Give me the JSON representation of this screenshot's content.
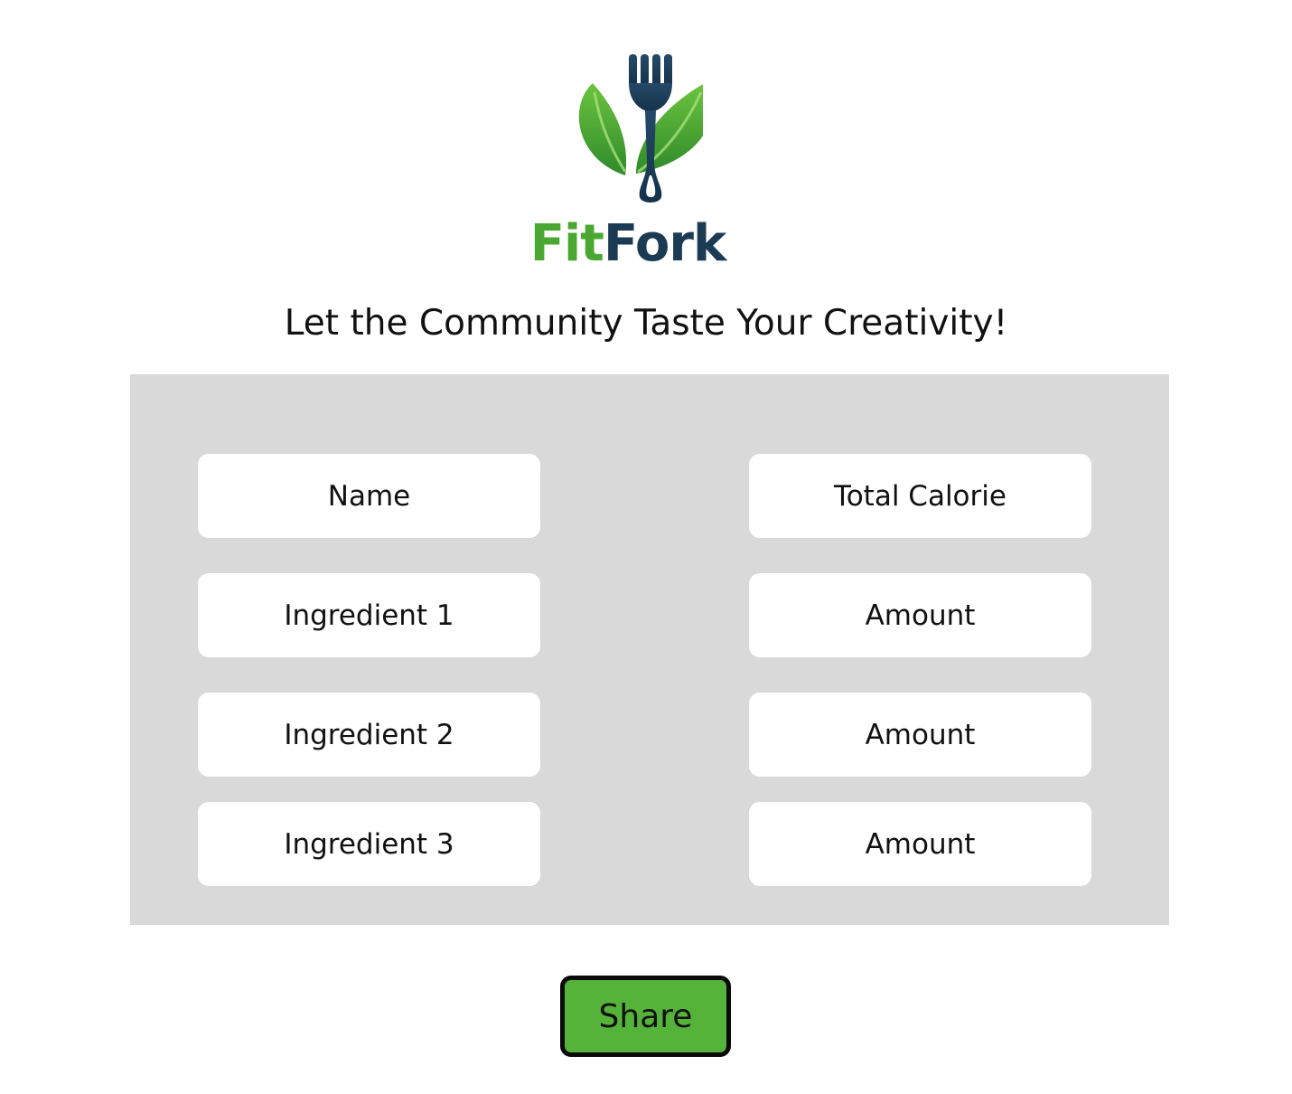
{
  "brand": {
    "name_part1": "Fit",
    "name_part2": "Fork",
    "logo_icon": "fork-with-leaves-icon",
    "colors": {
      "green": "#4aa832",
      "navy": "#1b3b55"
    }
  },
  "headline": "Let the Community Taste Your Creativity!",
  "form": {
    "name_placeholder": "Name",
    "total_calorie_placeholder": "Total Calorie",
    "ingredients": [
      {
        "ingredient_placeholder": "Ingredient 1",
        "amount_placeholder": "Amount"
      },
      {
        "ingredient_placeholder": "Ingredient 2",
        "amount_placeholder": "Amount"
      },
      {
        "ingredient_placeholder": "Ingredient 3",
        "amount_placeholder": "Amount"
      }
    ],
    "panel_color": "#d9d9d9"
  },
  "share_button": {
    "label": "Share",
    "color": "#56b33a"
  }
}
